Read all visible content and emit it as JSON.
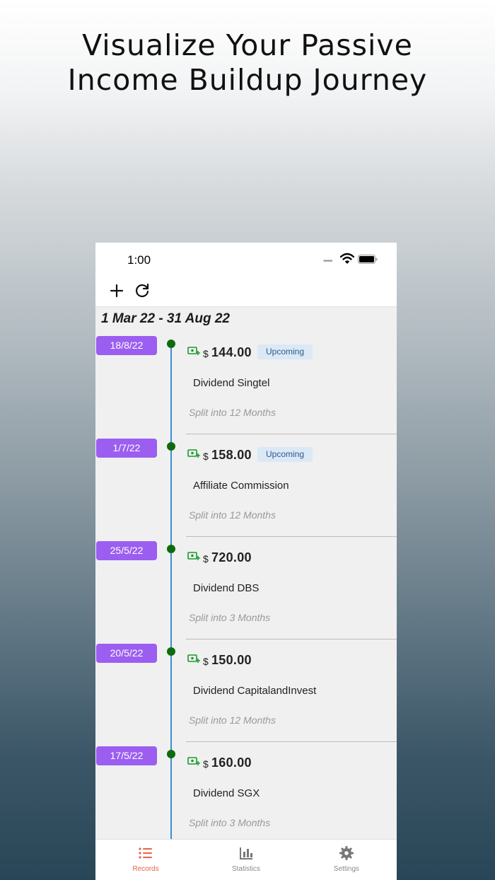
{
  "headline": {
    "line1": "Visualize Your Passive",
    "line2": "Income Buildup Journey"
  },
  "status_bar": {
    "time": "1:00",
    "signal": "•••••"
  },
  "toolbar": {
    "add_icon": "plus-icon",
    "refresh_icon": "refresh-icon"
  },
  "range_title": "1 Mar 22 - 31 Aug 22",
  "colors": {
    "date_pill": "#9b5ef0",
    "timeline": "#3a8fd0",
    "dot": "#0d6b0d",
    "active_tab": "#e8604c",
    "money_icon": "#1a9a2a"
  },
  "entries": [
    {
      "date": "18/8/22",
      "currency": "$",
      "amount": "144.00",
      "badge": "Upcoming",
      "name": "Dividend Singtel",
      "split": "Split into 12 Months"
    },
    {
      "date": "1/7/22",
      "currency": "$",
      "amount": "158.00",
      "badge": "Upcoming",
      "name": "Affiliate Commission",
      "split": "Split into 12 Months"
    },
    {
      "date": "25/5/22",
      "currency": "$",
      "amount": "720.00",
      "badge": "",
      "name": "Dividend DBS",
      "split": "Split into 3 Months"
    },
    {
      "date": "20/5/22",
      "currency": "$",
      "amount": "150.00",
      "badge": "",
      "name": "Dividend CapitalandInvest",
      "split": "Split into 12 Months"
    },
    {
      "date": "17/5/22",
      "currency": "$",
      "amount": "160.00",
      "badge": "",
      "name": "Dividend SGX",
      "split": "Split into 3 Months"
    }
  ],
  "tabs": [
    {
      "label": "Records",
      "icon": "list-icon",
      "active": true
    },
    {
      "label": "Statistics",
      "icon": "bar-chart-icon",
      "active": false
    },
    {
      "label": "Settings",
      "icon": "gear-icon",
      "active": false
    }
  ]
}
